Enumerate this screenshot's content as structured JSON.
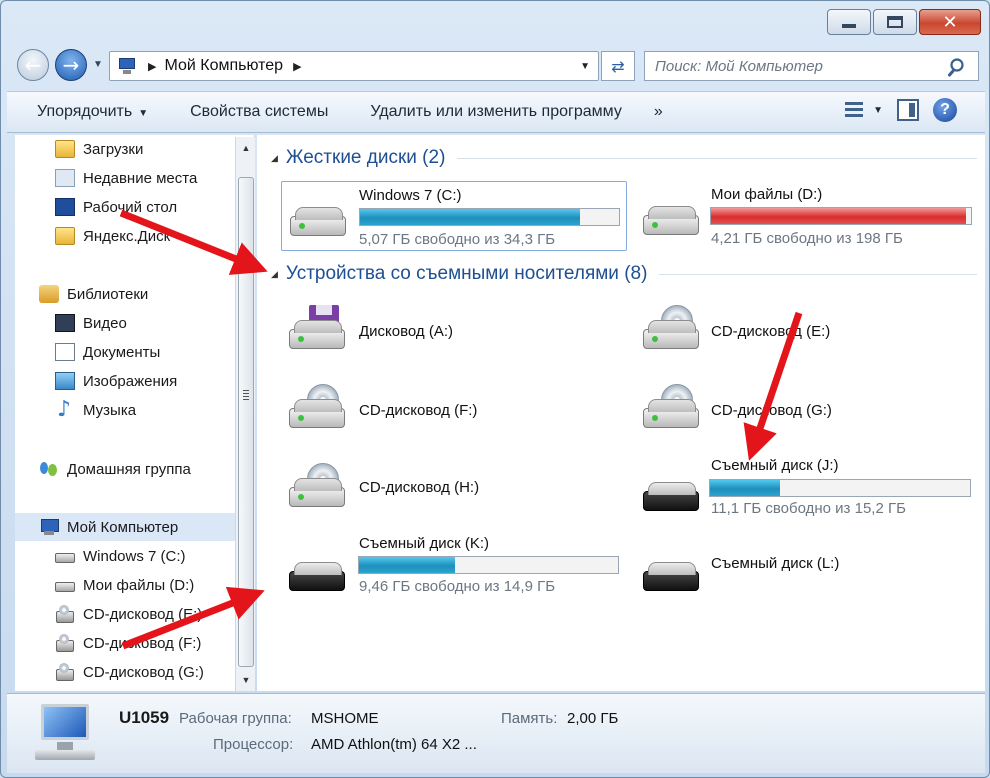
{
  "window": {
    "minimize_glyph": "",
    "close_glyph": "✕"
  },
  "address": {
    "path": "Мой Компьютер",
    "search_placeholder": "Поиск: Мой Компьютер"
  },
  "toolbar": {
    "organize": "Упорядочить",
    "system_properties": "Свойства системы",
    "uninstall": "Удалить или изменить программу",
    "more": "»"
  },
  "nav": {
    "items": [
      {
        "label": "Загрузки",
        "icon": "downloads-folder-icon"
      },
      {
        "label": "Недавние места",
        "icon": "recent-places-icon"
      },
      {
        "label": "Рабочий стол",
        "icon": "desktop-icon"
      },
      {
        "label": "Яндекс.Диск",
        "icon": "yandex-disk-folder-icon"
      },
      {
        "label": "Библиотеки",
        "icon": "libraries-icon"
      },
      {
        "label": "Видео",
        "icon": "video-icon"
      },
      {
        "label": "Документы",
        "icon": "documents-icon"
      },
      {
        "label": "Изображения",
        "icon": "pictures-icon"
      },
      {
        "label": "Музыка",
        "icon": "music-icon"
      },
      {
        "label": "Домашняя группа",
        "icon": "homegroup-icon"
      },
      {
        "label": "Мой Компьютер",
        "icon": "computer-icon"
      },
      {
        "label": "Windows 7 (C:)",
        "icon": "hard-drive-icon"
      },
      {
        "label": "Мои файлы (D:)",
        "icon": "hard-drive-icon"
      },
      {
        "label": "CD-дисковод (E:)",
        "icon": "cd-drive-icon"
      },
      {
        "label": "CD-дисковод (F:)",
        "icon": "cd-drive-icon"
      },
      {
        "label": "CD-дисковод (G:)",
        "icon": "cd-drive-icon"
      }
    ]
  },
  "groups": {
    "hard_drives": "Жесткие диски (2)",
    "removable": "Устройства со съемными носителями (8)"
  },
  "drives": {
    "c": {
      "name": "Windows 7 (C:)",
      "info": "5,07 ГБ свободно из 34,3 ГБ",
      "used": 0.85
    },
    "d": {
      "name": "Мои файлы (D:)",
      "info": "4,21 ГБ свободно из 198 ГБ",
      "used": 0.98
    },
    "a": {
      "name": "Дисковод (A:)"
    },
    "e": {
      "name": "CD-дисковод (E:)"
    },
    "f": {
      "name": "CD-дисковод (F:)"
    },
    "g": {
      "name": "CD-дисковод (G:)"
    },
    "h": {
      "name": "CD-дисковод (H:)"
    },
    "j": {
      "name": "Съемный диск (J:)",
      "info": "11,1 ГБ свободно из 15,2 ГБ",
      "used": 0.27
    },
    "k": {
      "name": "Съемный диск (K:)",
      "info": "9,46 ГБ свободно из 14,9 ГБ",
      "used": 0.37
    },
    "l": {
      "name": "Съемный диск (L:)"
    }
  },
  "details": {
    "computer_name": "U1059",
    "workgroup_label": "Рабочая группа:",
    "workgroup_value": "MSHOME",
    "memory_label": "Память:",
    "memory_value": "2,00 ГБ",
    "cpu_label": "Процессор:",
    "cpu_value": "AMD Athlon(tm) 64 X2 ..."
  },
  "colors": {
    "accent_blue": "#1e4f92",
    "bar_blue": "#1f8fbd",
    "bar_red": "#d92d2d",
    "arrow_red": "#e4141b"
  }
}
